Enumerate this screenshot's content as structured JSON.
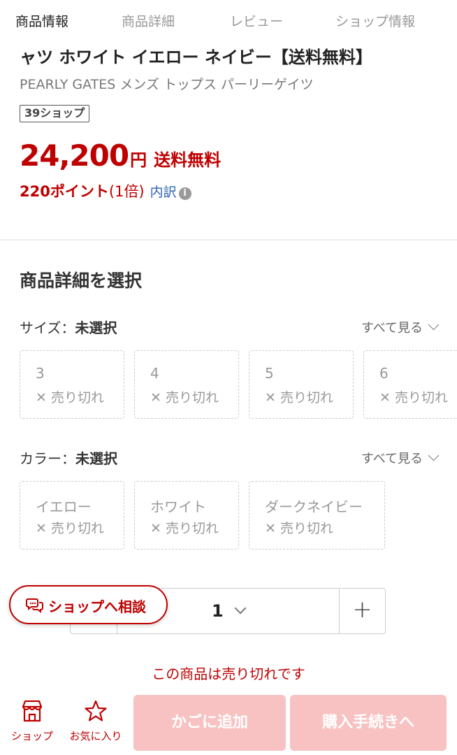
{
  "tabs": [
    {
      "label": "商品情報",
      "active": true
    },
    {
      "label": "商品詳細",
      "active": false
    },
    {
      "label": "レビュー",
      "active": false
    },
    {
      "label": "ショップ情報",
      "active": false
    }
  ],
  "product": {
    "title": "ャツ ホワイト イエロー ネイビー【送料無料】",
    "brand_line": "PEARLY GATES メンズ トップス パーリーゲイツ",
    "shop_badge": "39ショップ",
    "price": "24,200",
    "currency": "円",
    "shipping": "送料無料",
    "points": "220ポイント",
    "points_multiplier": "(1倍)",
    "breakdown_link": "内訳",
    "info_icon_glyph": "i"
  },
  "selection": {
    "title": "商品詳細を選択",
    "see_all_label": "すべて見る",
    "size": {
      "label": "サイズ：",
      "selected": "未選択",
      "options": [
        {
          "name": "3",
          "status": "✕ 売り切れ"
        },
        {
          "name": "4",
          "status": "✕ 売り切れ"
        },
        {
          "name": "5",
          "status": "✕ 売り切れ"
        },
        {
          "name": "6",
          "status": "✕ 売り切れ"
        }
      ]
    },
    "color": {
      "label": "カラー：",
      "selected": "未選択",
      "options": [
        {
          "name": "イエロー",
          "status": "✕ 売り切れ"
        },
        {
          "name": "ホワイト",
          "status": "✕ 売り切れ"
        },
        {
          "name": "ダークネイビー",
          "status": "✕ 売り切れ"
        }
      ]
    }
  },
  "quantity": {
    "value": "1",
    "plus_glyph": "+"
  },
  "consult_button": {
    "label": "ショップへ相談"
  },
  "soldout_message": "この商品は売り切れです",
  "bottom_bar": {
    "shop_label": "ショップ",
    "favorite_label": "お気に入り",
    "add_to_cart_label": "かごに追加",
    "checkout_label": "購入手続きへ"
  },
  "colors": {
    "accent": "#bf0000",
    "disabled_button": "#f8c2c2",
    "link": "#2a65b1"
  },
  "icons": [
    "info-icon",
    "chevron-down-icon",
    "chat-bubbles-icon",
    "store-icon",
    "star-icon",
    "plus-icon"
  ]
}
